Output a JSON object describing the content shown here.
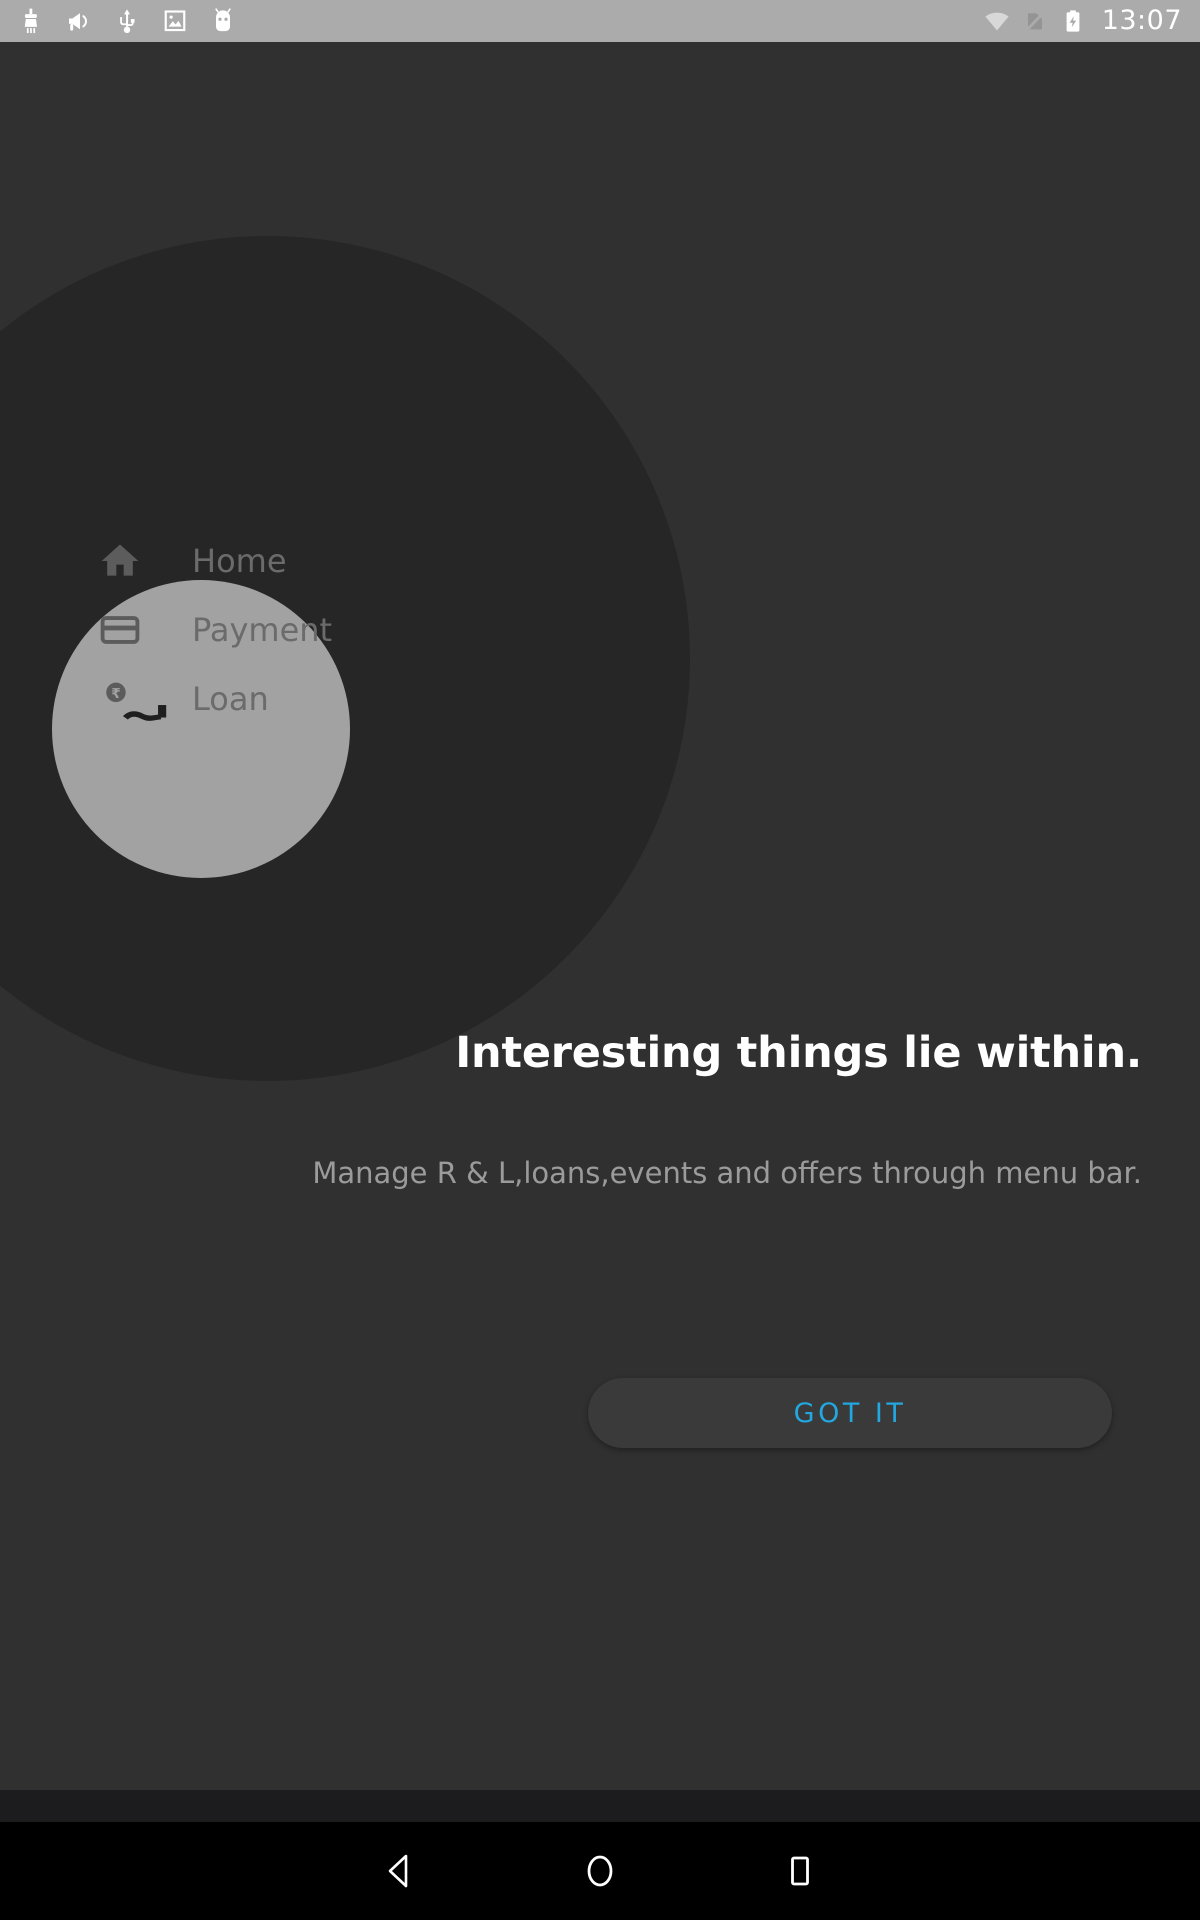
{
  "status_bar": {
    "background_color": "#ababab",
    "left_icons": [
      {
        "name": "cleaner-brush-icon",
        "label": "Cleaner"
      },
      {
        "name": "megaphone-icon",
        "label": "Announcement"
      },
      {
        "name": "usb-icon",
        "label": "USB connected"
      },
      {
        "name": "image-icon",
        "label": "Screenshot captured"
      },
      {
        "name": "android-head-icon",
        "label": "Android system"
      }
    ],
    "right_icons": [
      {
        "name": "wifi-icon",
        "label": "Wi-Fi"
      },
      {
        "name": "no-sim-icon",
        "label": "No SIM"
      },
      {
        "name": "battery-charging-icon",
        "label": "Battery charging"
      }
    ],
    "clock": "13:07"
  },
  "spotlight": {
    "backdrop_color": "#262626",
    "reveal_color": "#a2a2a2",
    "page_background": "#303030"
  },
  "menu": {
    "items": [
      {
        "label": "Home",
        "icon": "home-icon"
      },
      {
        "label": "Payment",
        "icon": "credit-card-icon"
      },
      {
        "label": "Loan",
        "icon": "rupee-hand-icon"
      }
    ]
  },
  "showcase": {
    "title": "Interesting things lie within.",
    "subtitle": "Manage R & L,loans,events and offers through menu bar.",
    "dismiss_label": "GOT IT",
    "dismiss_color": "#22a7e0"
  },
  "navigation_bar": {
    "buttons": [
      {
        "name": "nav-back-button",
        "label": "Back"
      },
      {
        "name": "nav-home-button",
        "label": "Home"
      },
      {
        "name": "nav-recents-button",
        "label": "Recents"
      }
    ]
  }
}
